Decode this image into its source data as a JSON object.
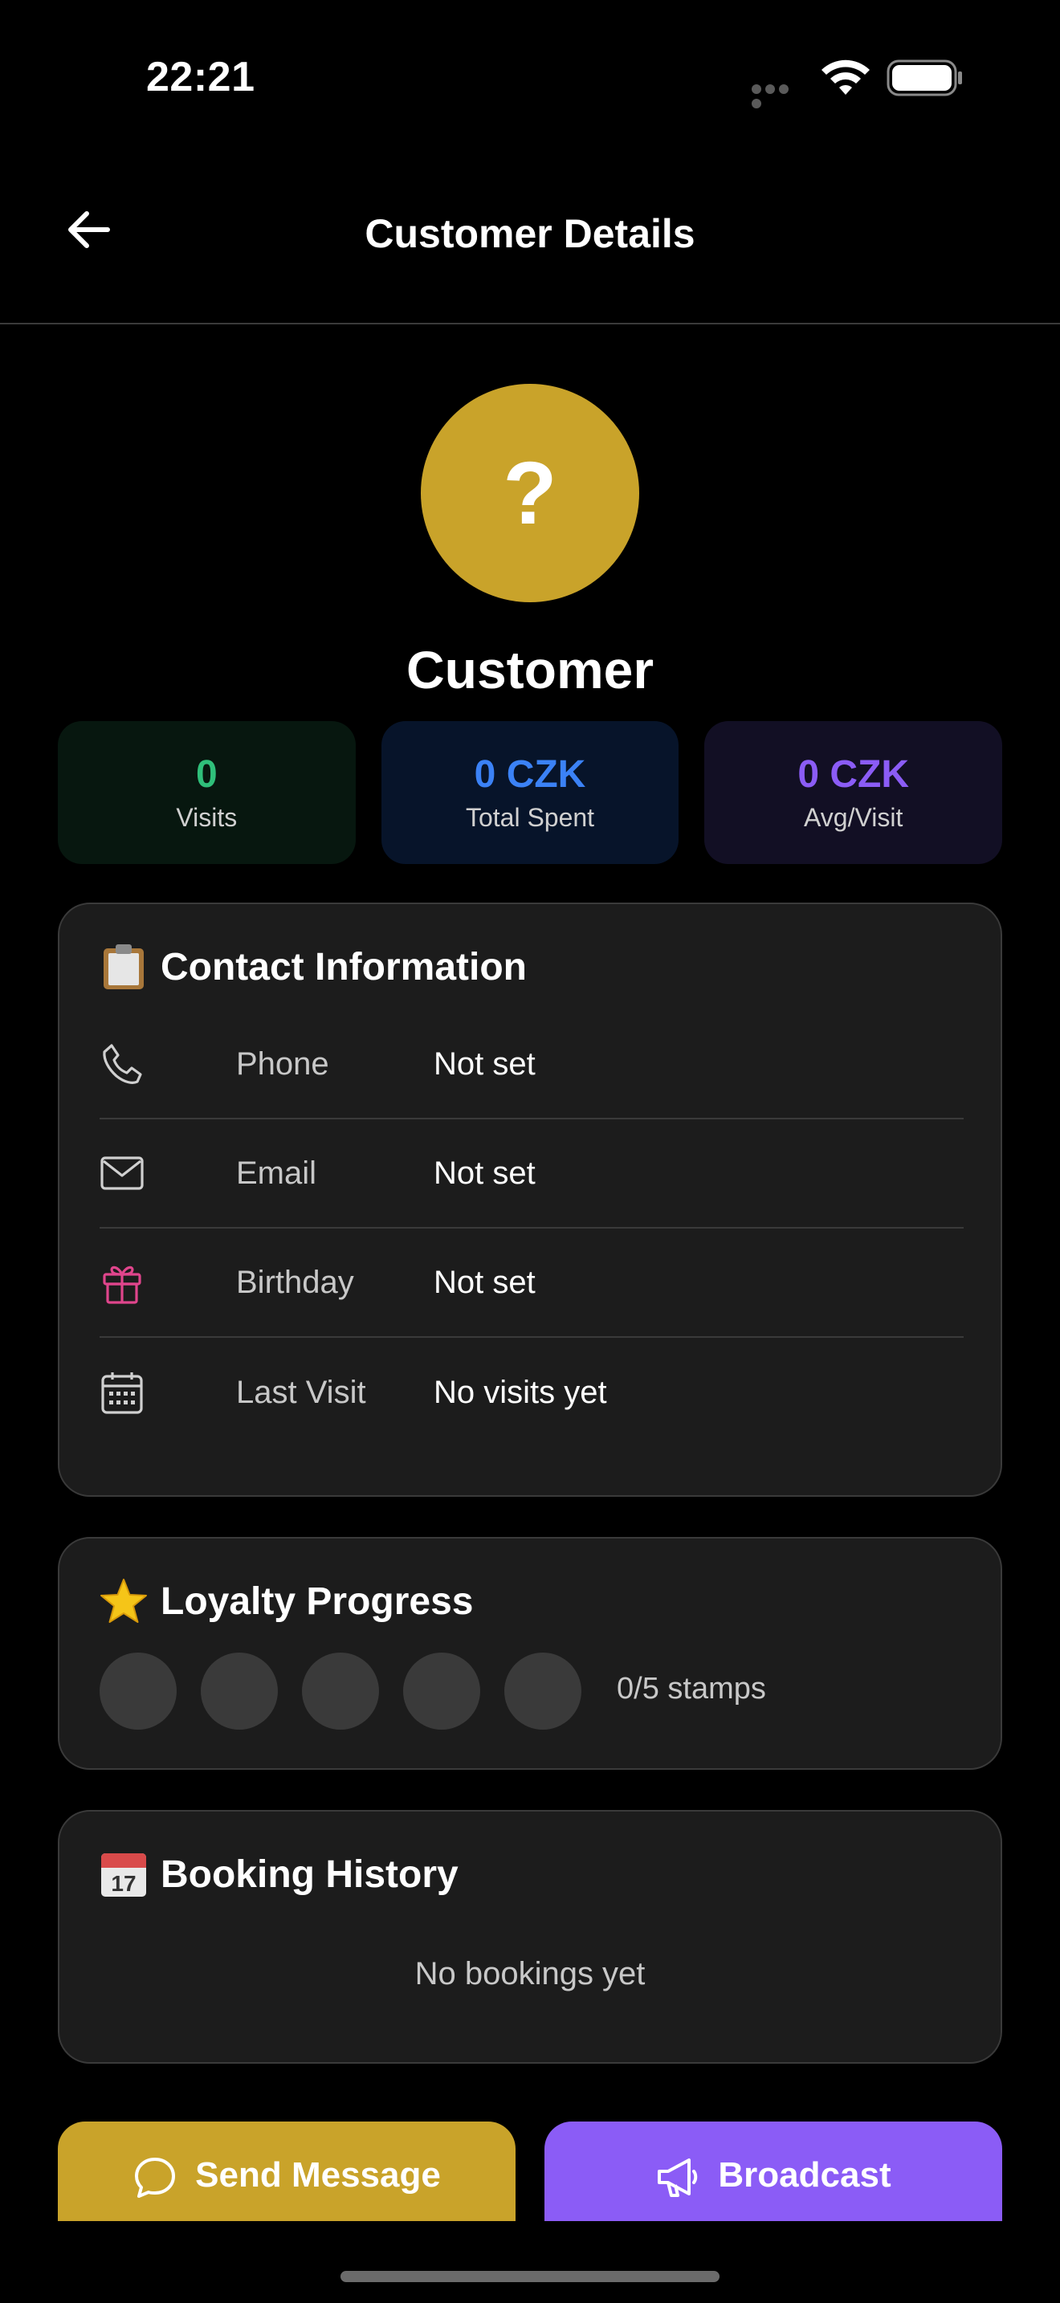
{
  "status_bar": {
    "time": "22:21"
  },
  "nav": {
    "title": "Customer Details"
  },
  "profile": {
    "avatar_text": "?",
    "name": "Customer",
    "avatar_color": "#c9a32a"
  },
  "stats": {
    "visits": {
      "value": "0",
      "label": "Visits",
      "color": "#2fbf7a"
    },
    "total_spent": {
      "value": "0 CZK",
      "label": "Total Spent",
      "color": "#3b82f6"
    },
    "avg_visit": {
      "value": "0 CZK",
      "label": "Avg/Visit",
      "color": "#8b5cf6"
    }
  },
  "contact": {
    "title": "Contact Information",
    "title_icon": "clipboard-icon",
    "rows": [
      {
        "icon": "phone-icon",
        "label": "Phone",
        "value": "Not set"
      },
      {
        "icon": "mail-icon",
        "label": "Email",
        "value": "Not set"
      },
      {
        "icon": "gift-icon",
        "label": "Birthday",
        "value": "Not set"
      },
      {
        "icon": "calendar-icon",
        "label": "Last Visit",
        "value": "No visits yet"
      }
    ]
  },
  "loyalty": {
    "title": "Loyalty Progress",
    "title_icon": "star-icon",
    "stamps_filled": 0,
    "stamps_total": 5,
    "stamps_text": "0/5 stamps"
  },
  "bookings": {
    "title": "Booking History",
    "title_icon": "calendar-emoji-icon",
    "empty_text": "No bookings yet"
  },
  "actions": {
    "send_message": {
      "label": "Send Message",
      "icon": "chat-bubble-icon",
      "color": "#c9a32a"
    },
    "broadcast": {
      "label": "Broadcast",
      "icon": "megaphone-icon",
      "color": "#8b5cf6"
    }
  }
}
